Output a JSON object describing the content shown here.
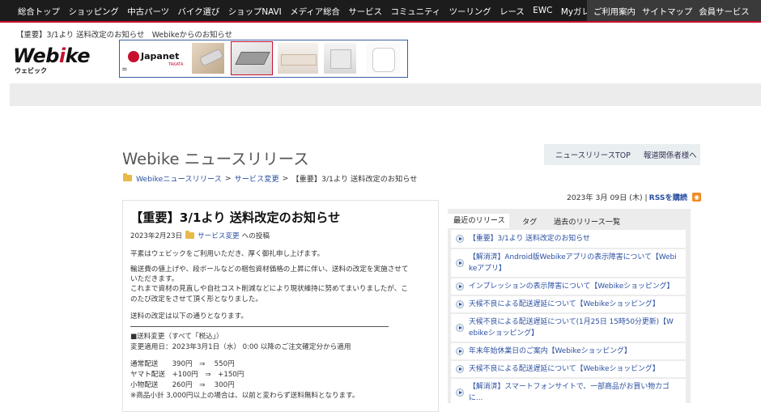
{
  "nav": {
    "items": [
      "総合トップ",
      "ショッピング",
      "中古パーツ",
      "バイク選び",
      "ショップNAVI",
      "メディア総合",
      "サービス",
      "コミュニティ",
      "ツーリング",
      "レース",
      "EWC",
      "Myガレージ"
    ],
    "right_items": [
      "ご利用案内",
      "サイトマップ",
      "会員サービス"
    ]
  },
  "announcement": "【重要】3/1より 送料改定のお知らせ　Webikeからのお知らせ",
  "logo": {
    "word_a": "Web",
    "word_b": "i",
    "word_c": "ke",
    "sub": "ウェビック"
  },
  "banner": {
    "brand_main": "Japanet",
    "brand_sub": "TAKATA",
    "eq": "="
  },
  "page": {
    "title": "Webike ニュースリリース",
    "subnav": [
      "ニュースリリースTOP",
      "報道関係者様へ"
    ]
  },
  "breadcrumb": {
    "items": [
      "Webikeニュースリリース",
      "サービス変更",
      "【重要】3/1より 送料改定のお知らせ"
    ],
    "sep": ">"
  },
  "date_line": {
    "date": "2023年 3月 09日 (木) |",
    "rss": "RSSを購読"
  },
  "article": {
    "title": "【重要】3/1より 送料改定のお知らせ",
    "meta_date": "2023年2月23日",
    "meta_category": "サービス変更",
    "meta_suffix": "への投稿",
    "lines": [
      "平素はウェビックをご利用いただき、厚く御礼申し上げます。",
      "輸送費の値上げや、段ボールなどの梱包資材価格の上昇に伴い、送料の改定を実施させて",
      "いただきます。",
      "これまで資材の見直しや自社コスト削減などにより現状維持に努めてまいりましたが、こ",
      "のたび改定をさせて頂く形となりました。",
      "送料の改定は以下の通りとなります。",
      "■送料変更（すべて「税込」）",
      "変更適用日：2023年3月1日（水） 0:00 以降のご注文確定分から適用",
      "通常配送　　390円　⇒　 550円",
      "ヤマト配送　+100円　⇒　+150円",
      "小物配送　　260円　⇒　 300円",
      "※商品小計 3,000円以上の場合は、以前と変わらず送料無料となります。"
    ]
  },
  "sidebar": {
    "tabs": [
      "最近のリリース",
      "タグ",
      "過去のリリース一覧"
    ],
    "items": [
      [
        "【重要】3/1より 送料改定のお知らせ"
      ],
      [
        "【解消済】Android版Webikeアプリの表示障害について【Webi",
        "keアプリ】"
      ],
      [
        "インプレッションの表示障害について【Webikeショッピング】"
      ],
      [
        "天候不良による配送遅延について【Webikeショッピング】"
      ],
      [
        "天候不良による配送遅延について(1月25日 15時50分更新)【W",
        "ebikeショッピング】"
      ],
      [
        "年末年始休業日のご案内【Webikeショッピング】"
      ],
      [
        "天候不良による配送遅延について【Webikeショッピング】"
      ],
      [
        "【解消済】スマートフォンサイトで、一部商品がお買い物カゴ",
        "に..."
      ]
    ]
  }
}
